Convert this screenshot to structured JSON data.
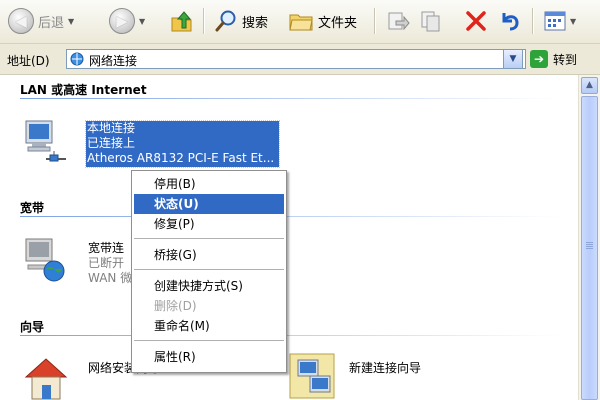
{
  "toolbar": {
    "back_label": "后退",
    "search_label": "搜索",
    "folders_label": "文件夹"
  },
  "address": {
    "label": "地址(D)",
    "value": "网络连接",
    "go_label": "转到"
  },
  "groups": {
    "lan": "LAN 或高速 Internet",
    "broadband": "宽带",
    "wizard": "向导"
  },
  "items": {
    "local": {
      "name": "本地连接",
      "status": "已连接上",
      "device": "Atheros AR8132 PCI-E Fast Et..."
    },
    "broadband": {
      "name": "宽带连",
      "status": "已断开",
      "device": "WAN 微"
    },
    "home_wizard": {
      "name": "网络安装向导"
    },
    "new_conn_wizard": {
      "name": "新建连接向导"
    }
  },
  "context_menu": {
    "disable": "停用(B)",
    "status": "状态(U)",
    "repair": "修复(P)",
    "bridge": "桥接(G)",
    "shortcut": "创建快捷方式(S)",
    "delete": "删除(D)",
    "rename": "重命名(M)",
    "properties": "属性(R)"
  },
  "colors": {
    "selection": "#316ac5",
    "toolbar_bg": "#ece9d8"
  }
}
